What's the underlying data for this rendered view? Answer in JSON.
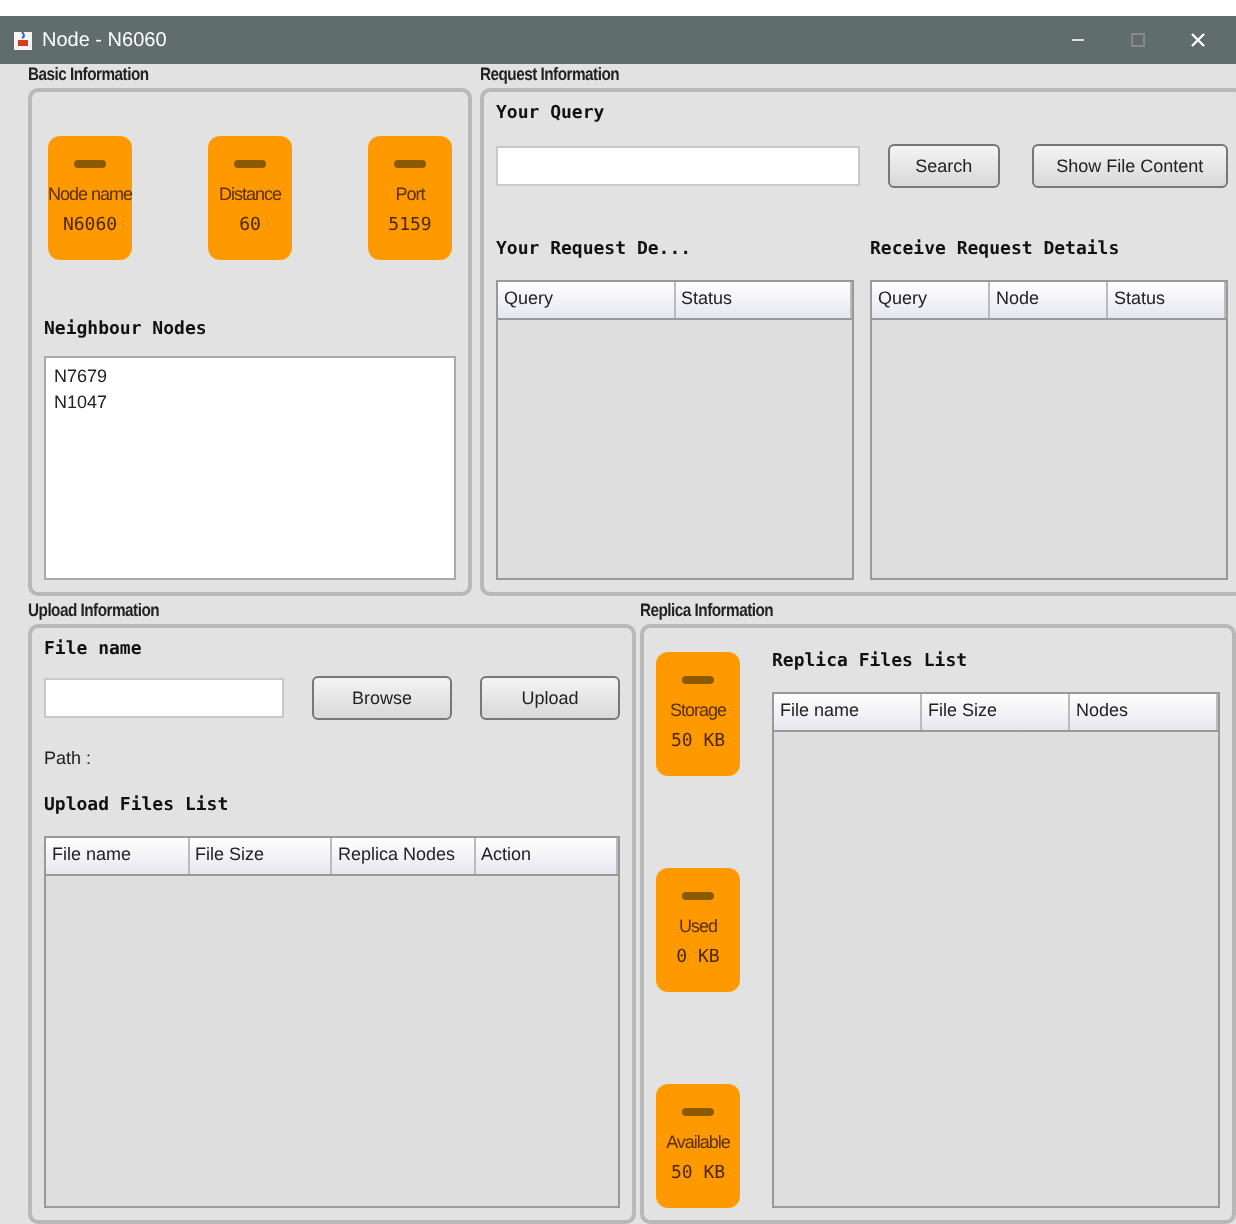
{
  "window": {
    "title": "Node - N6060"
  },
  "basic_information": {
    "title": "Basic Information",
    "cards": [
      {
        "label": "Node name",
        "value": "N6060"
      },
      {
        "label": "Distance",
        "value": "60"
      },
      {
        "label": "Port",
        "value": "5159"
      }
    ],
    "neighbours_label": "Neighbour Nodes",
    "neighbours": [
      "N7679",
      "N1047"
    ]
  },
  "request_information": {
    "title": "Request Information",
    "query_label": "Your Query",
    "buttons": [
      "Search",
      "Show File Content"
    ],
    "your_requests": {
      "title": "Your Request De...",
      "columns": [
        "Query",
        "Status"
      ]
    },
    "received_requests": {
      "title": "Receive Request Details",
      "columns": [
        "Query",
        "Node",
        "Status"
      ]
    }
  },
  "upload_information": {
    "title": "Upload Information",
    "file_label": "File name",
    "buttons": [
      "Browse",
      "Upload"
    ],
    "path_label": "Path :",
    "list_title": "Upload Files List",
    "columns": [
      "File name",
      "File Size",
      "Replica Nodes",
      "Action"
    ]
  },
  "replica_information": {
    "title": "Replica Information",
    "cards": [
      {
        "label": "Storage",
        "value": "50 KB"
      },
      {
        "label": "Used",
        "value": "0 KB"
      },
      {
        "label": "Available",
        "value": "50 KB"
      }
    ],
    "list_title": "Replica Files List",
    "columns": [
      "File name",
      "File Size",
      "Nodes"
    ]
  }
}
